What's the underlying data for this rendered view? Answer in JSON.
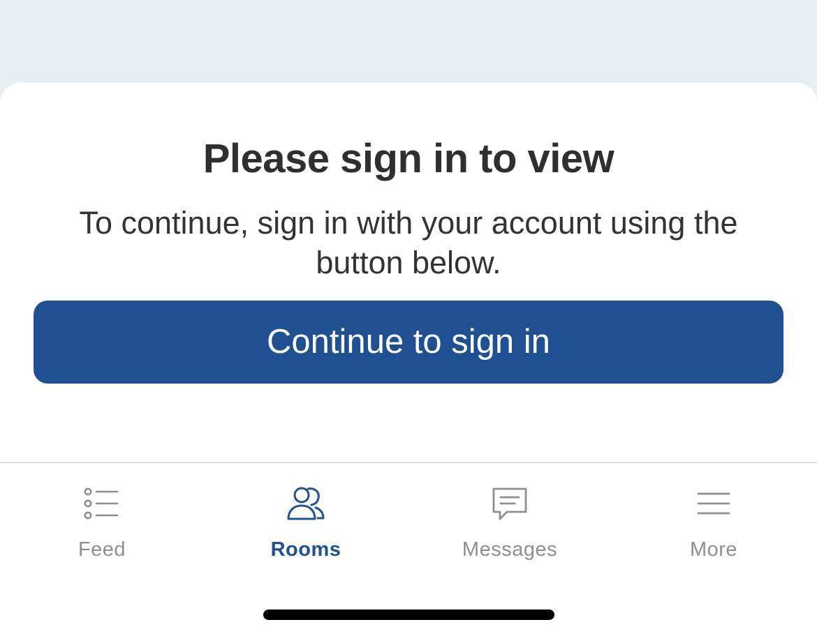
{
  "signin_prompt": {
    "title": "Please sign in to view",
    "message": "To continue, sign in with your account using the button below.",
    "button_label": "Continue to sign in"
  },
  "tab_bar": {
    "tabs": [
      {
        "label": "Feed",
        "icon": "list-icon",
        "active": false
      },
      {
        "label": "Rooms",
        "icon": "people-icon",
        "active": true
      },
      {
        "label": "Messages",
        "icon": "chat-bubble-icon",
        "active": false
      },
      {
        "label": "More",
        "icon": "hamburger-menu-icon",
        "active": false
      }
    ]
  },
  "colors": {
    "primary": "#1f5192",
    "background": "#e8ecf3",
    "inactive_tab": "#8e8e93",
    "title_text": "#2f2f2f"
  }
}
